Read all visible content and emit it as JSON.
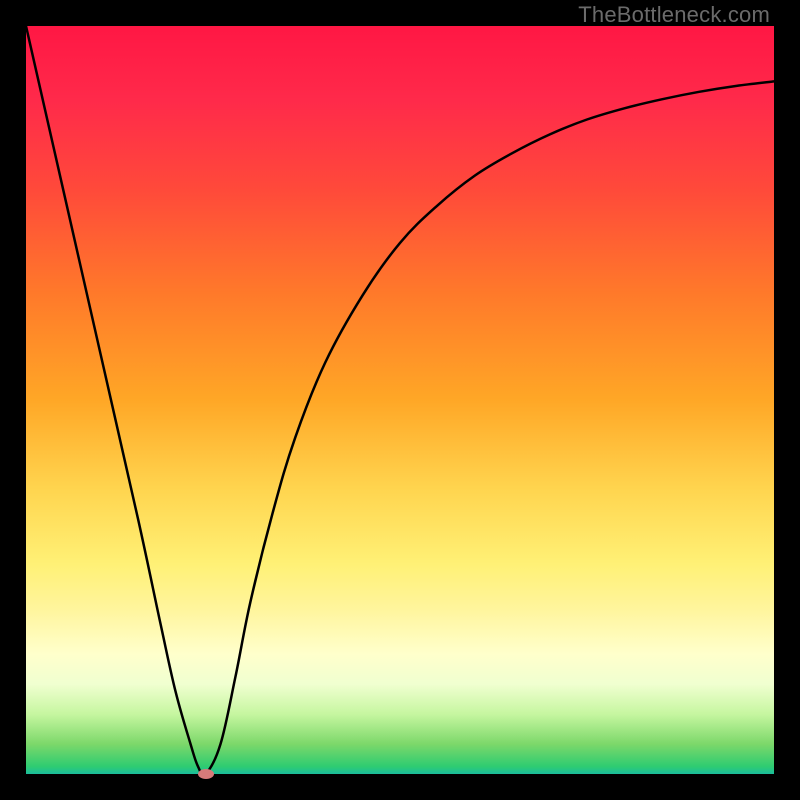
{
  "watermark": "TheBottleneck.com",
  "chart_data": {
    "type": "line",
    "title": "",
    "xlabel": "",
    "ylabel": "",
    "xlim": [
      0,
      100
    ],
    "ylim": [
      0,
      100
    ],
    "grid": false,
    "series": [
      {
        "name": "bottleneck-curve",
        "x": [
          0,
          5,
          10,
          15,
          18,
          20,
          22,
          23,
          24,
          26,
          28,
          30,
          33,
          36,
          40,
          45,
          50,
          55,
          60,
          65,
          70,
          75,
          80,
          85,
          90,
          95,
          100
        ],
        "values": [
          100,
          78,
          56,
          34,
          20,
          11,
          4,
          1,
          0,
          4,
          13,
          23,
          35,
          45,
          55,
          64,
          71,
          76,
          80,
          83,
          85.5,
          87.5,
          89,
          90.2,
          91.2,
          92,
          92.6
        ]
      }
    ],
    "annotations": [
      {
        "name": "min-marker",
        "x": 24,
        "y": 0
      }
    ],
    "background_gradient": {
      "direction": "vertical",
      "stops": [
        {
          "pos": 0.0,
          "color": "#ff1744"
        },
        {
          "pos": 0.5,
          "color": "#ffa726"
        },
        {
          "pos": 0.72,
          "color": "#fff176"
        },
        {
          "pos": 0.92,
          "color": "#c6f6a0"
        },
        {
          "pos": 1.0,
          "color": "#1abc9c"
        }
      ]
    }
  }
}
